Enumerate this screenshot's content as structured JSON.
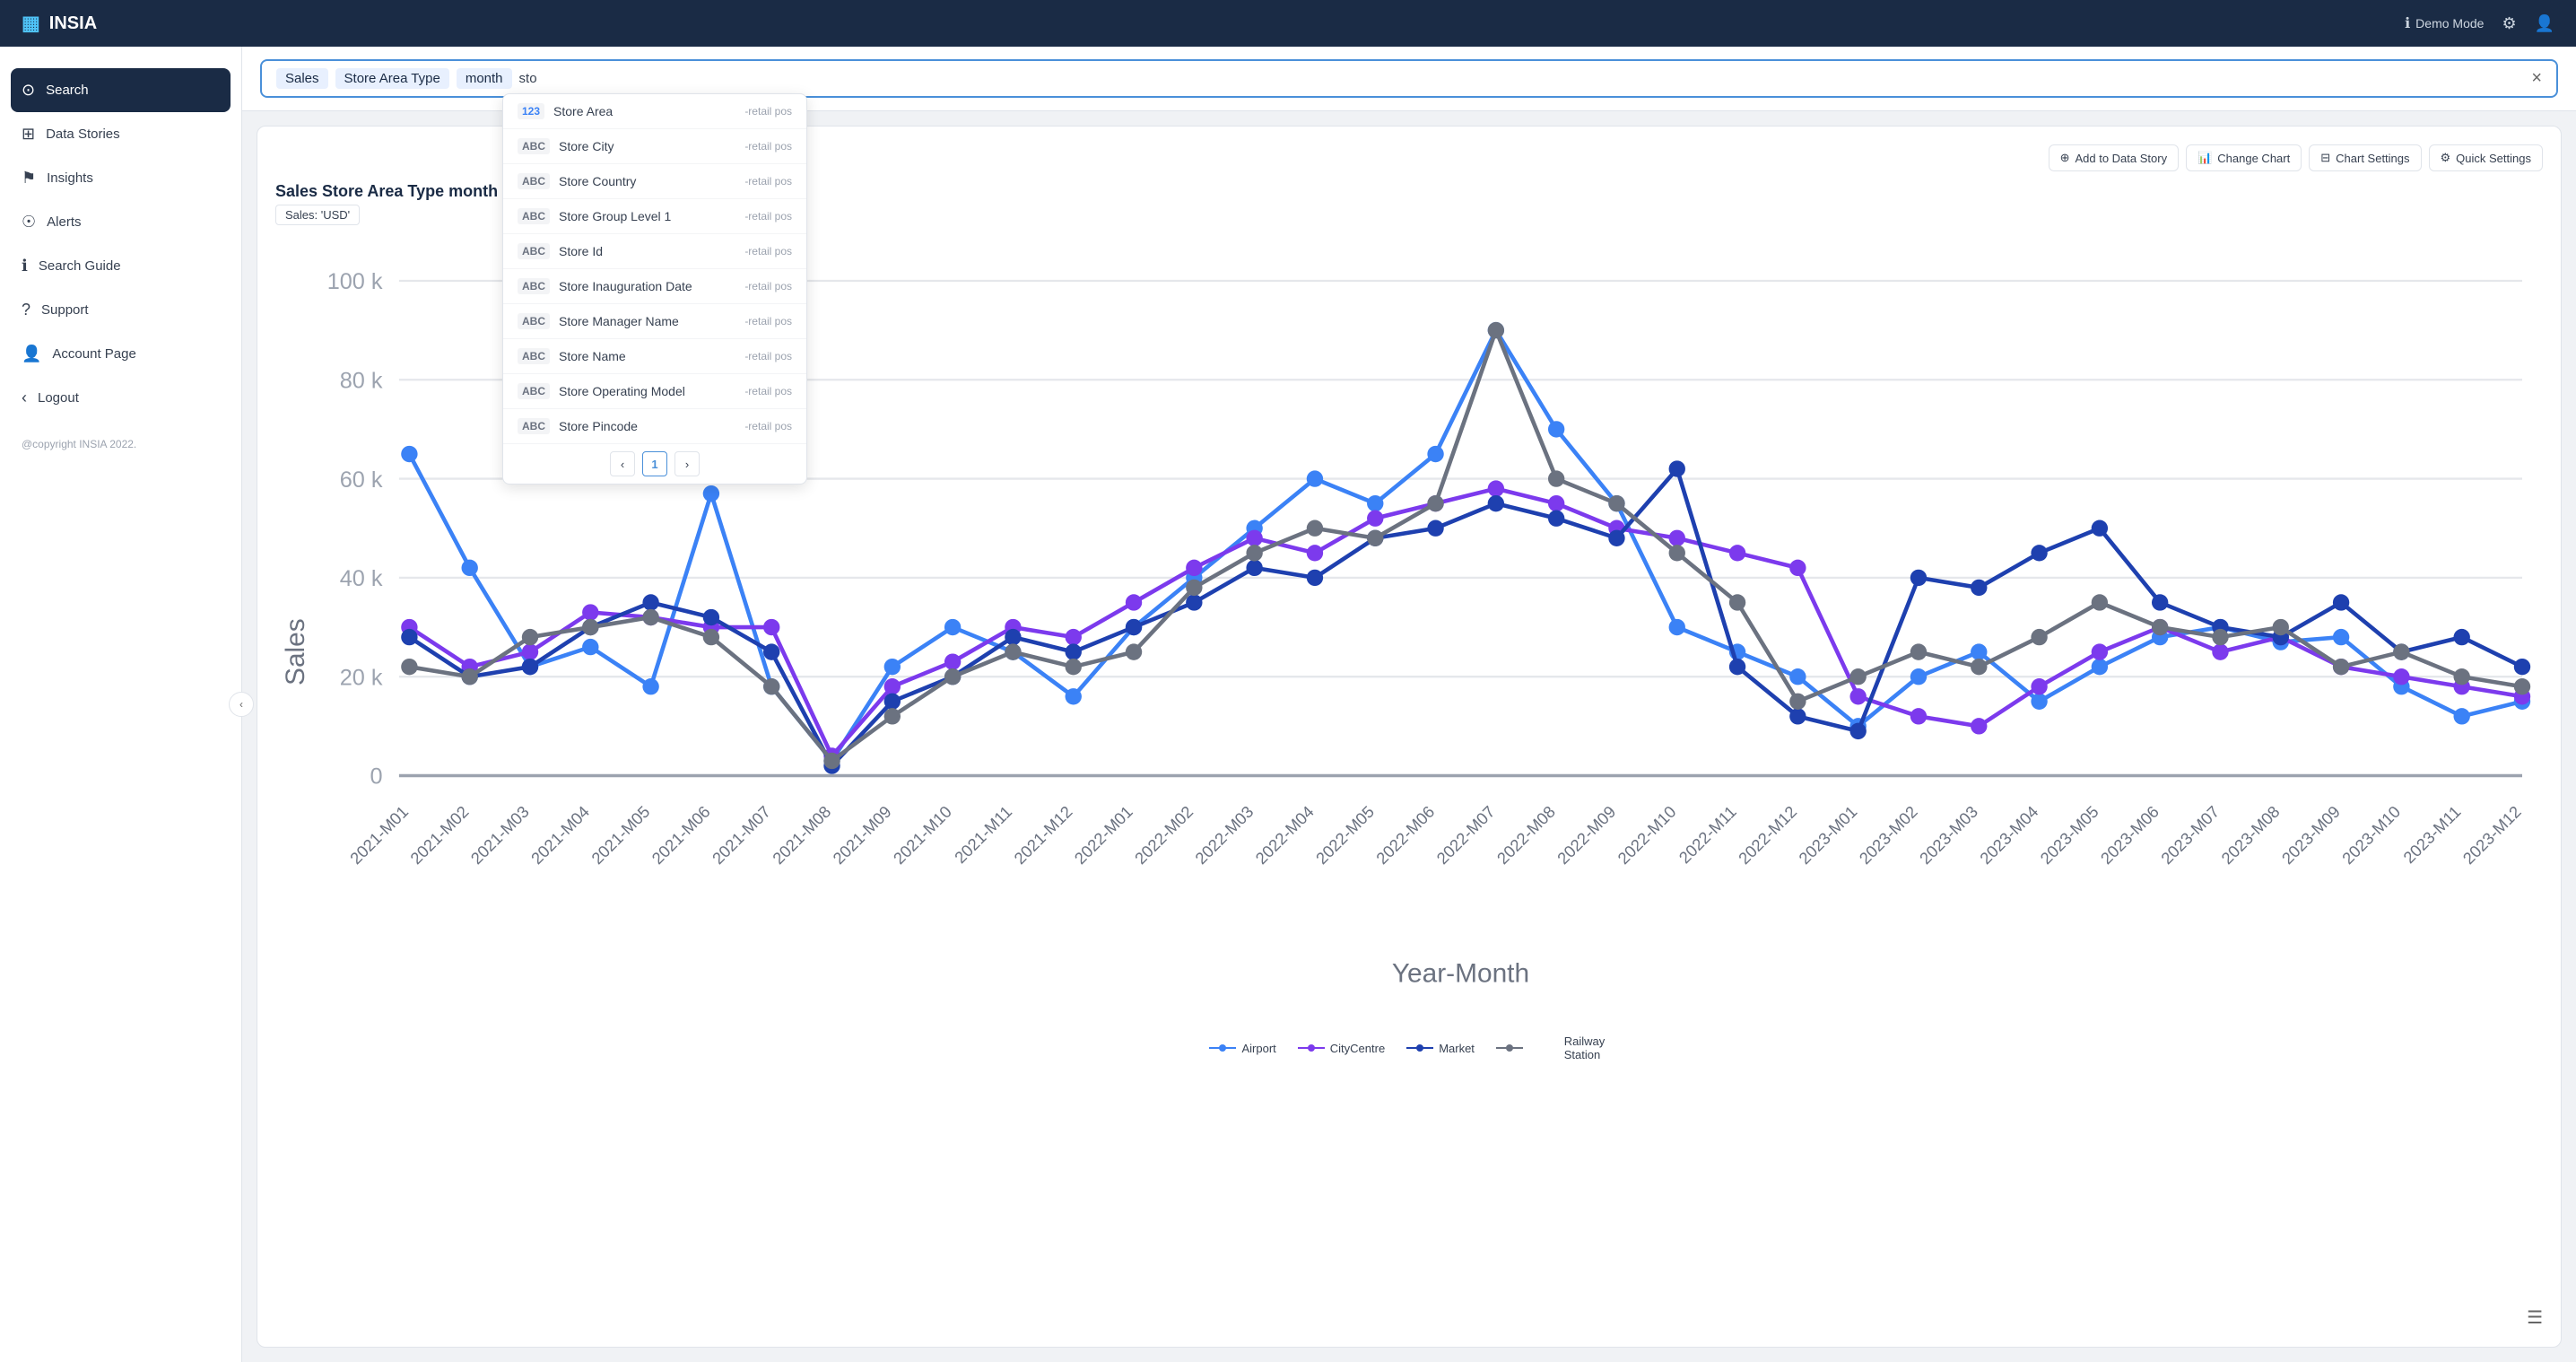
{
  "header": {
    "logo": "INSIA",
    "demo_mode_label": "Demo Mode",
    "logo_icon": "▦"
  },
  "sidebar": {
    "toggle_icon": "‹",
    "items": [
      {
        "id": "search",
        "label": "Search",
        "icon": "⊙",
        "active": true
      },
      {
        "id": "data-stories",
        "label": "Data Stories",
        "icon": "⊞"
      },
      {
        "id": "insights",
        "label": "Insights",
        "icon": "⚑"
      },
      {
        "id": "alerts",
        "label": "Alerts",
        "icon": "☉"
      },
      {
        "id": "search-guide",
        "label": "Search Guide",
        "icon": "ℹ"
      },
      {
        "id": "support",
        "label": "Support",
        "icon": "?"
      },
      {
        "id": "account-page",
        "label": "Account Page",
        "icon": "👤"
      },
      {
        "id": "logout",
        "label": "Logout",
        "icon": "‹"
      }
    ],
    "footer": "@copyright INSIA 2022."
  },
  "search": {
    "tokens": [
      "Sales",
      "Store Area Type",
      "month"
    ],
    "current_input": "sto",
    "close_label": "×"
  },
  "dropdown": {
    "items": [
      {
        "type": "num",
        "name": "Store Area",
        "source": "-retail pos"
      },
      {
        "type": "abc",
        "name": "Store City",
        "source": "-retail pos"
      },
      {
        "type": "abc",
        "name": "Store Country",
        "source": "-retail pos"
      },
      {
        "type": "abc",
        "name": "Store Group Level 1",
        "source": "-retail pos"
      },
      {
        "type": "abc",
        "name": "Store Id",
        "source": "-retail pos"
      },
      {
        "type": "abc",
        "name": "Store Inauguration Date",
        "source": "-retail pos"
      },
      {
        "type": "abc",
        "name": "Store Manager Name",
        "source": "-retail pos"
      },
      {
        "type": "abc",
        "name": "Store Name",
        "source": "-retail pos"
      },
      {
        "type": "abc",
        "name": "Store Operating Model",
        "source": "-retail pos"
      },
      {
        "type": "abc",
        "name": "Store Pincode",
        "source": "-retail pos"
      }
    ],
    "page": "1",
    "prev_icon": "‹",
    "next_icon": "›"
  },
  "chart": {
    "title": "Sales Store Area Type month",
    "filter_label": "Sales: 'USD'",
    "toolbar": {
      "add_to_data_story": "Add to Data Story",
      "change_chart": "Change Chart",
      "chart_settings": "Chart Settings",
      "quick_settings": "Quick Settings"
    },
    "y_axis_label": "Sales",
    "x_axis_label": "Year-Month",
    "y_ticks": [
      "100 k",
      "80 k",
      "60 k",
      "40 k",
      "20 k",
      "0"
    ],
    "x_labels": [
      "2021-M01",
      "2021-M02",
      "2021-M03",
      "2021-M04",
      "2021-M05",
      "2021-M06",
      "2021-M07",
      "2021-M08",
      "2021-M09",
      "2021-M10",
      "2021-M11",
      "2021-M12",
      "2022-M01",
      "2022-M02",
      "2022-M03",
      "2022-M04",
      "2022-M05",
      "2022-M06",
      "2022-M07",
      "2022-M08",
      "2022-M09",
      "2022-M10",
      "2022-M11",
      "2022-M12",
      "2023-M01",
      "2023-M02",
      "2023-M03",
      "2023-M04",
      "2023-M05",
      "2023-M06",
      "2023-M07",
      "2023-M08",
      "2023-M09",
      "2023-M10",
      "2023-M11",
      "2023-M12"
    ],
    "series": [
      {
        "name": "Airport",
        "color": "#3b82f6",
        "values": [
          65,
          42,
          22,
          26,
          18,
          57,
          18,
          3,
          22,
          30,
          25,
          16,
          30,
          40,
          50,
          60,
          55,
          65,
          90,
          70,
          55,
          30,
          25,
          20,
          10,
          20,
          25,
          15,
          22,
          28,
          30,
          27,
          28,
          18,
          12,
          15
        ]
      },
      {
        "name": "CityCentre",
        "color": "#7c3aed",
        "values": [
          30,
          22,
          25,
          33,
          32,
          30,
          30,
          4,
          18,
          23,
          30,
          28,
          35,
          42,
          48,
          45,
          52,
          55,
          58,
          55,
          50,
          48,
          45,
          42,
          16,
          12,
          10,
          18,
          25,
          30,
          25,
          28,
          22,
          20,
          18,
          16
        ]
      },
      {
        "name": "Market",
        "color": "#1e40af",
        "values": [
          28,
          20,
          22,
          30,
          35,
          32,
          25,
          2,
          15,
          20,
          28,
          25,
          30,
          35,
          42,
          40,
          48,
          50,
          55,
          52,
          48,
          62,
          22,
          12,
          9,
          40,
          38,
          45,
          50,
          35,
          30,
          28,
          35,
          25,
          28,
          22
        ]
      },
      {
        "name": "Railway Station",
        "color": "#6b7280",
        "values": [
          22,
          20,
          28,
          30,
          32,
          28,
          18,
          3,
          12,
          20,
          25,
          22,
          25,
          38,
          45,
          50,
          48,
          55,
          90,
          60,
          55,
          45,
          35,
          15,
          20,
          25,
          22,
          28,
          35,
          30,
          28,
          30,
          22,
          25,
          20,
          18
        ]
      }
    ]
  }
}
